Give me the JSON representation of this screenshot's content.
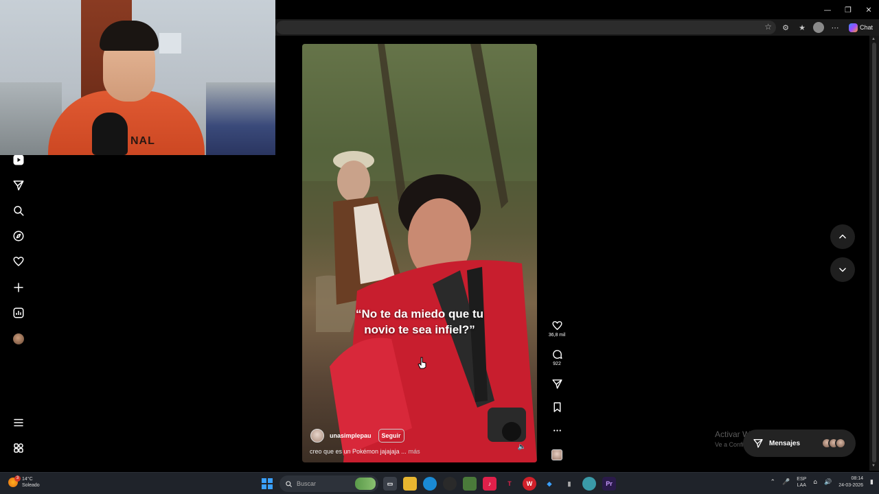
{
  "browser": {
    "window_controls": {
      "minimize": "—",
      "restore": "❐",
      "close": "✕"
    },
    "chat_label": "Chat"
  },
  "webcam": {
    "shirt_text": "NAL"
  },
  "left_nav": {
    "items": [
      {
        "name": "reels-icon"
      },
      {
        "name": "direct-send-icon"
      },
      {
        "name": "search-icon"
      },
      {
        "name": "explore-icon"
      },
      {
        "name": "heart-icon"
      },
      {
        "name": "create-plus-icon"
      },
      {
        "name": "dashboard-icon"
      },
      {
        "name": "profile-avatar"
      }
    ],
    "bottom": [
      {
        "name": "menu-icon"
      },
      {
        "name": "also-from-meta-icon"
      }
    ]
  },
  "reel": {
    "caption_line1": "“No te da miedo que tu",
    "caption_line2": "novio te sea infiel?”",
    "username": "unasimplepau",
    "follow_label": "Seguir",
    "description": "creo que es un Pokémon jajajaja ...",
    "more_label": "más"
  },
  "actions": {
    "likes": "36,8 mil",
    "comments": "922"
  },
  "messages": {
    "label": "Mensajes"
  },
  "watermark": {
    "title": "Activar Windows",
    "subtitle": "Ve a Configuración para activar Windows."
  },
  "taskbar": {
    "weather_temp": "14°C",
    "weather_cond": "Soleado",
    "weather_badge": "3",
    "search_placeholder": "Buscar",
    "lang_1": "ESP",
    "lang_2": "LAA",
    "time": "08:14",
    "date": "24-03-2026"
  },
  "colors": {
    "accent_blue": "#3aa0ff",
    "page_bg": "#000000",
    "pill_bg": "#232323"
  }
}
